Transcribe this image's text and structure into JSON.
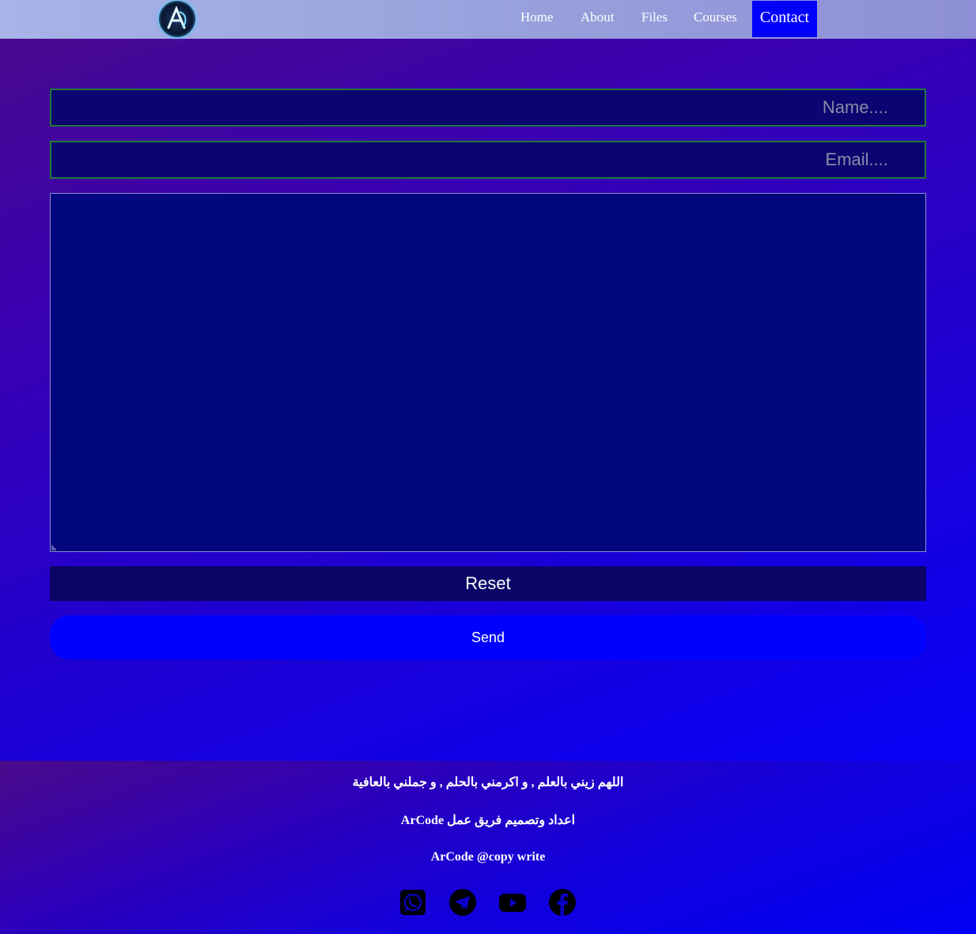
{
  "nav": {
    "logo_letter": "A",
    "links": [
      "Home",
      "About",
      "Files",
      "Courses"
    ],
    "active": "Contact"
  },
  "form": {
    "name_placeholder": "....Name",
    "email_placeholder": "....Email",
    "message_value": "",
    "reset_label": "Reset",
    "send_label": "Send"
  },
  "footer": {
    "line1": "اللهم زيني بالعلم , و اكرمني بالحلم , و جملني بالعافية",
    "line2": "اعداد وتصميم فريق عمل ArCode",
    "line3": "ArCode @copy write",
    "social_icons": [
      "whatsapp-icon",
      "telegram-icon",
      "youtube-icon",
      "facebook-icon"
    ]
  },
  "colors": {
    "accent": "#0000ff",
    "field_border": "#1f7a3a",
    "field_bg": "#0a0570"
  }
}
